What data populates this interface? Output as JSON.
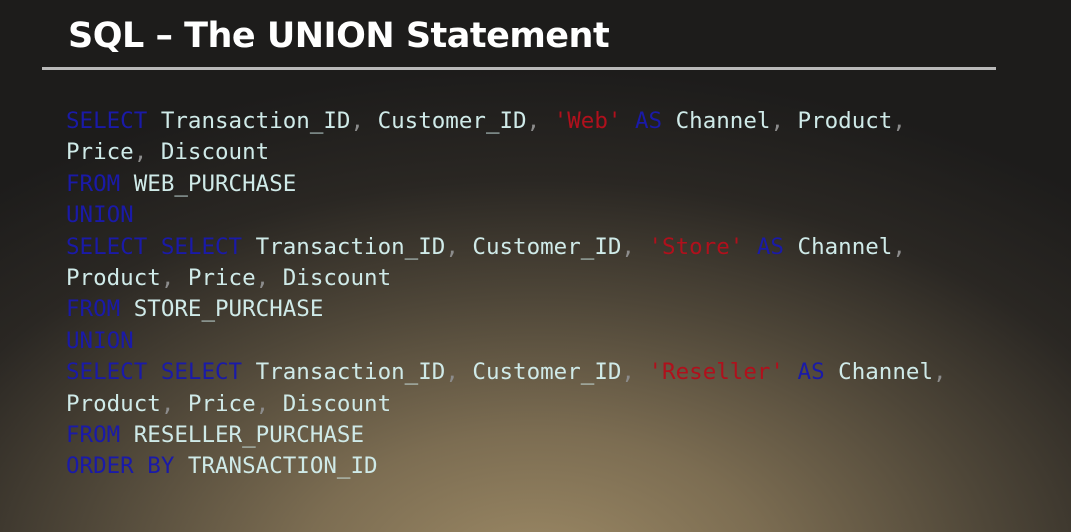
{
  "slide": {
    "title": "SQL – The UNION Statement"
  },
  "colors": {
    "keyword": "#1a1aa8",
    "identifier": "#cfeae8",
    "punctuation": "#8c8c8c",
    "string": "#b0101c",
    "title": "#ffffff",
    "rule": "#b9b9b9"
  },
  "code_lines": [
    [
      {
        "t": "keyword",
        "v": "SELECT"
      },
      {
        "t": "space",
        "v": " "
      },
      {
        "t": "identifier",
        "v": "Transaction_ID"
      },
      {
        "t": "punct",
        "v": ","
      },
      {
        "t": "space",
        "v": " "
      },
      {
        "t": "identifier",
        "v": "Customer_ID"
      },
      {
        "t": "punct",
        "v": ","
      },
      {
        "t": "space",
        "v": " "
      },
      {
        "t": "string",
        "v": "'Web'"
      },
      {
        "t": "space",
        "v": " "
      },
      {
        "t": "keyword",
        "v": "AS"
      },
      {
        "t": "space",
        "v": " "
      },
      {
        "t": "identifier",
        "v": "Channel"
      },
      {
        "t": "punct",
        "v": ","
      },
      {
        "t": "space",
        "v": " "
      },
      {
        "t": "identifier",
        "v": "Product"
      },
      {
        "t": "punct",
        "v": ","
      }
    ],
    [
      {
        "t": "identifier",
        "v": "Price"
      },
      {
        "t": "punct",
        "v": ","
      },
      {
        "t": "space",
        "v": " "
      },
      {
        "t": "identifier",
        "v": "Discount"
      }
    ],
    [
      {
        "t": "keyword",
        "v": "FROM"
      },
      {
        "t": "space",
        "v": " "
      },
      {
        "t": "identifier",
        "v": "WEB_PURCHASE"
      }
    ],
    [
      {
        "t": "keyword",
        "v": "UNION"
      }
    ],
    [
      {
        "t": "keyword",
        "v": "SELECT"
      },
      {
        "t": "space",
        "v": " "
      },
      {
        "t": "keyword",
        "v": "SELECT"
      },
      {
        "t": "space",
        "v": " "
      },
      {
        "t": "identifier",
        "v": "Transaction_ID"
      },
      {
        "t": "punct",
        "v": ","
      },
      {
        "t": "space",
        "v": " "
      },
      {
        "t": "identifier",
        "v": "Customer_ID"
      },
      {
        "t": "punct",
        "v": ","
      },
      {
        "t": "space",
        "v": " "
      },
      {
        "t": "string",
        "v": "'Store'"
      },
      {
        "t": "space",
        "v": " "
      },
      {
        "t": "keyword",
        "v": "AS"
      },
      {
        "t": "space",
        "v": " "
      },
      {
        "t": "identifier",
        "v": "Channel"
      },
      {
        "t": "punct",
        "v": ","
      }
    ],
    [
      {
        "t": "identifier",
        "v": "Product"
      },
      {
        "t": "punct",
        "v": ","
      },
      {
        "t": "space",
        "v": " "
      },
      {
        "t": "identifier",
        "v": "Price"
      },
      {
        "t": "punct",
        "v": ","
      },
      {
        "t": "space",
        "v": " "
      },
      {
        "t": "identifier",
        "v": "Discount"
      }
    ],
    [
      {
        "t": "keyword",
        "v": "FROM"
      },
      {
        "t": "space",
        "v": " "
      },
      {
        "t": "identifier",
        "v": "STORE_PURCHASE"
      }
    ],
    [
      {
        "t": "keyword",
        "v": "UNION"
      }
    ],
    [
      {
        "t": "keyword",
        "v": "SELECT"
      },
      {
        "t": "space",
        "v": " "
      },
      {
        "t": "keyword",
        "v": "SELECT"
      },
      {
        "t": "space",
        "v": " "
      },
      {
        "t": "identifier",
        "v": "Transaction_ID"
      },
      {
        "t": "punct",
        "v": ","
      },
      {
        "t": "space",
        "v": " "
      },
      {
        "t": "identifier",
        "v": "Customer_ID"
      },
      {
        "t": "punct",
        "v": ","
      },
      {
        "t": "space",
        "v": " "
      },
      {
        "t": "string",
        "v": "'Reseller'"
      },
      {
        "t": "space",
        "v": " "
      },
      {
        "t": "keyword",
        "v": "AS"
      },
      {
        "t": "space",
        "v": " "
      },
      {
        "t": "identifier",
        "v": "Channel"
      },
      {
        "t": "punct",
        "v": ","
      }
    ],
    [
      {
        "t": "identifier",
        "v": "Product"
      },
      {
        "t": "punct",
        "v": ","
      },
      {
        "t": "space",
        "v": " "
      },
      {
        "t": "identifier",
        "v": "Price"
      },
      {
        "t": "punct",
        "v": ","
      },
      {
        "t": "space",
        "v": " "
      },
      {
        "t": "identifier",
        "v": "Discount"
      }
    ],
    [
      {
        "t": "keyword",
        "v": "FROM"
      },
      {
        "t": "space",
        "v": " "
      },
      {
        "t": "identifier",
        "v": "RESELLER_PURCHASE"
      }
    ],
    [
      {
        "t": "keyword",
        "v": "ORDER BY"
      },
      {
        "t": "space",
        "v": " "
      },
      {
        "t": "identifier",
        "v": "TRANSACTION_ID"
      }
    ]
  ]
}
